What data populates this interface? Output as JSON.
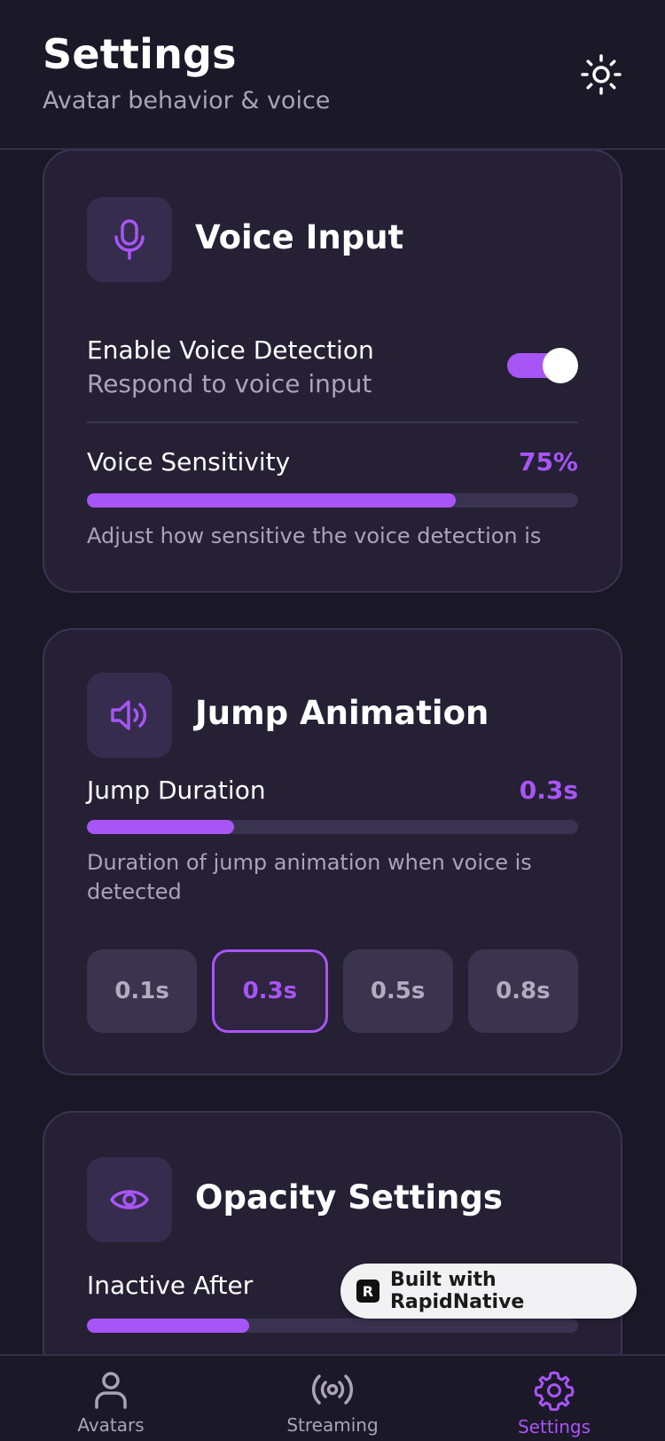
{
  "header": {
    "title": "Settings",
    "subtitle": "Avatar behavior & voice",
    "theme_icon": "sun-icon"
  },
  "voice_input": {
    "title": "Voice Input",
    "icon": "microphone-icon",
    "enable": {
      "label": "Enable Voice Detection",
      "sublabel": "Respond to voice input",
      "enabled": true
    },
    "sensitivity": {
      "label": "Voice Sensitivity",
      "value_text": "75%",
      "fraction": 0.75,
      "help": "Adjust how sensitive the voice detection is"
    }
  },
  "jump_animation": {
    "title": "Jump Animation",
    "icon": "speaker-icon",
    "duration": {
      "label": "Jump Duration",
      "value_text": "0.3s",
      "fraction": 0.3,
      "help": "Duration of jump animation when voice is detected"
    },
    "presets": [
      "0.1s",
      "0.3s",
      "0.5s",
      "0.8s"
    ],
    "selected_preset": "0.3s"
  },
  "opacity_settings": {
    "title": "Opacity Settings",
    "icon": "eye-icon",
    "inactive_after": {
      "label": "Inactive After",
      "fraction": 0.33
    }
  },
  "badge": {
    "text": "Built with RapidNative"
  },
  "bottom_nav": {
    "items": [
      {
        "label": "Avatars",
        "icon": "person-icon",
        "active": false
      },
      {
        "label": "Streaming",
        "icon": "broadcast-icon",
        "active": false
      },
      {
        "label": "Settings",
        "icon": "gear-icon",
        "active": true
      }
    ]
  },
  "colors": {
    "accent": "#a855f7",
    "background": "#1a1726",
    "card": "#252034"
  }
}
